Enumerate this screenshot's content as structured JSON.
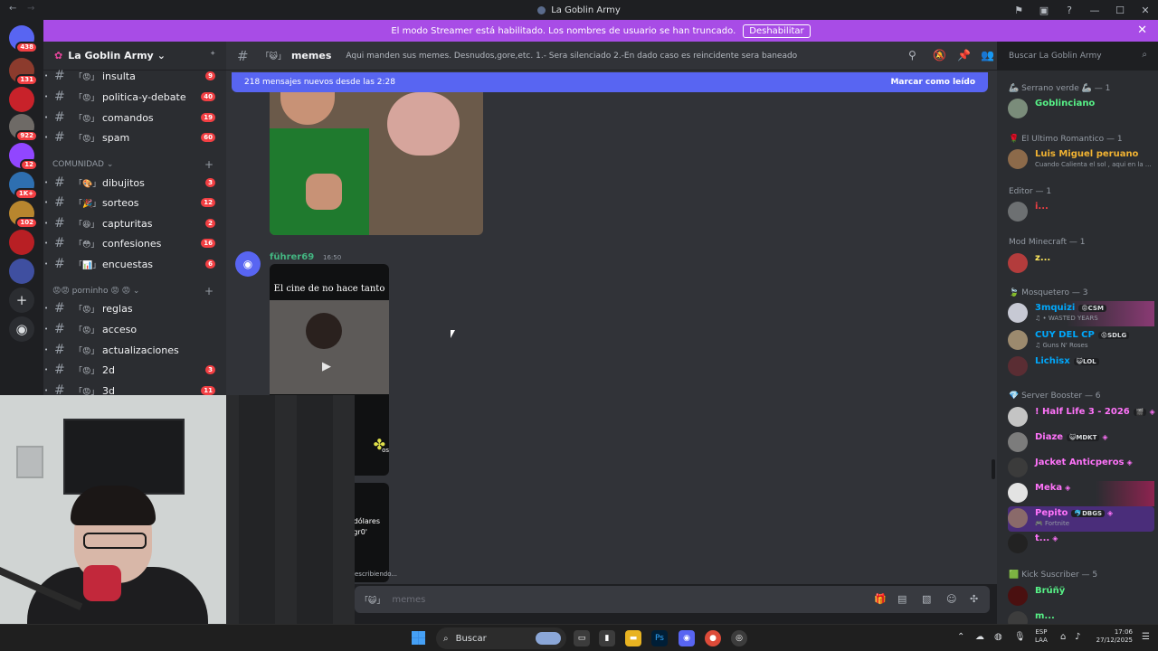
{
  "window": {
    "title": "La Goblin Army",
    "back": "←",
    "forward": "→",
    "controls": [
      "⚑",
      "▣",
      "?",
      "—",
      "☐",
      "✕"
    ]
  },
  "banner": {
    "text": "El modo Streamer está habilitado. Los nombres de usuario se han truncado.",
    "button": "Deshabilitar",
    "close": "✕"
  },
  "server_badges": [
    "438",
    "131",
    "922",
    "12",
    "1K+",
    "102"
  ],
  "guild": {
    "name": "La Goblin Army",
    "chevron": "⌄"
  },
  "channels_top": [
    {
      "emoji": "「😡」",
      "name": "insulta",
      "count": "9"
    },
    {
      "emoji": "「😡」",
      "name": "politica-y-debate",
      "count": "40"
    },
    {
      "emoji": "「😡」",
      "name": "comandos",
      "count": "19"
    },
    {
      "emoji": "「😡」",
      "name": "spam",
      "count": "60"
    }
  ],
  "category_comunidad": "COMUNIDAD ⌄",
  "channels_comunidad": [
    {
      "emoji": "「🎨」",
      "name": "dibujitos",
      "count": "3"
    },
    {
      "emoji": "「🎉」",
      "name": "sorteos",
      "count": "12"
    },
    {
      "emoji": "「😆」",
      "name": "capturitas",
      "count": "2"
    },
    {
      "emoji": "「😳」",
      "name": "confesiones",
      "count": "16"
    },
    {
      "emoji": "「📊」",
      "name": "encuestas",
      "count": "6"
    }
  ],
  "category_porninho": "😡😡 porninho 😡 😡 ⌄",
  "channels_porninho": [
    {
      "emoji": "「😡」",
      "name": "reglas",
      "count": ""
    },
    {
      "emoji": "「😡」",
      "name": "acceso",
      "count": ""
    },
    {
      "emoji": "「😡」",
      "name": "actualizaciones",
      "count": ""
    },
    {
      "emoji": "「😡」",
      "name": "2d",
      "count": "3"
    },
    {
      "emoji": "「😡」",
      "name": "3d",
      "count": "11"
    }
  ],
  "channel_header": {
    "emoji": "「😺」",
    "name": "memes",
    "topic": "Aqui manden sus memes. Desnudos,gore,etc. 1.- Sera silenciado 2.-En dado caso es reincidente sera baneado"
  },
  "search_placeholder": "Buscar La Goblin Army",
  "new_messages": {
    "text": "218 mensajes nuevos desde las 2:28",
    "mark": "Marcar como leído"
  },
  "message": {
    "author": "führer69",
    "time": "16:50",
    "video_caption": "El cine de  no hace tanto",
    "video_text2": "os",
    "video2_line1": "dólares",
    "video2_line2": "gr0'"
  },
  "typing": "escribiendo...",
  "composer": {
    "emoji": "「😺」",
    "placeholder": "memes"
  },
  "member_groups": [
    {
      "header": "🦾 Serrano verde 🦾 — 1",
      "members": [
        {
          "name": "Goblinciano",
          "color": "#57f287",
          "sub": "",
          "tag": "",
          "boost": ""
        }
      ]
    },
    {
      "header": "🌹 El Ultimo Romantico — 1",
      "members": [
        {
          "name": "Luis Miguel peruano",
          "color": "#f0b232",
          "sub": "Cuando Calienta el sol , aqui en la ...",
          "tag": "",
          "boost": ""
        }
      ]
    },
    {
      "header": "Editor — 1",
      "members": [
        {
          "name": "i...",
          "color": "#f23f43",
          "sub": "",
          "tag": "",
          "boost": ""
        }
      ]
    },
    {
      "header": "Mod Minecraft — 1",
      "members": [
        {
          "name": "z...",
          "color": "#fee75c",
          "sub": "",
          "tag": "",
          "boost": ""
        }
      ]
    },
    {
      "header": "🍃 Mosquetero — 3",
      "members": [
        {
          "name": "3mquizi",
          "color": "#00a8fc",
          "sub": "♫ • WASTED YEARS",
          "tag": "😡CSM",
          "boost": ""
        },
        {
          "name": "CUY DEL CP",
          "color": "#00a8fc",
          "sub": "♫ Guns N' Roses",
          "tag": "😡SDLG",
          "boost": ""
        },
        {
          "name": "Lichisx",
          "color": "#00a8fc",
          "sub": "",
          "tag": "😺LOL",
          "boost": ""
        }
      ]
    },
    {
      "header": "💎 Server Booster — 6",
      "members": [
        {
          "name": "! Half Life 3 - 2026",
          "color": "#ff73fa",
          "sub": "",
          "tag": "🎬",
          "boost": "◈"
        },
        {
          "name": "Diaze",
          "color": "#ff73fa",
          "sub": "",
          "tag": "😺MDKT",
          "boost": "◈"
        },
        {
          "name": "Jacket Anticperos",
          "color": "#ff73fa",
          "sub": "",
          "tag": "",
          "boost": "◈"
        },
        {
          "name": "Meka",
          "color": "#ff73fa",
          "sub": "",
          "tag": "",
          "boost": "◈"
        },
        {
          "name": "Pepito",
          "color": "#ff73fa",
          "sub": "🎮 Fortnite",
          "tag": "🐬DBGS",
          "boost": "◈"
        },
        {
          "name": "t...",
          "color": "#ff73fa",
          "sub": "",
          "tag": "",
          "boost": "◈"
        }
      ]
    },
    {
      "header": "🟩 Kick Suscriber — 5",
      "members": [
        {
          "name": "Brúñÿ",
          "color": "#57f287",
          "sub": "",
          "tag": "",
          "boost": ""
        },
        {
          "name": "m...",
          "color": "#57f287",
          "sub": "",
          "tag": "",
          "boost": ""
        }
      ]
    }
  ],
  "taskbar": {
    "search": "Buscar",
    "lang1": "ESP",
    "lang2": "LAA",
    "time": "17:06",
    "date": "27/12/2025"
  }
}
